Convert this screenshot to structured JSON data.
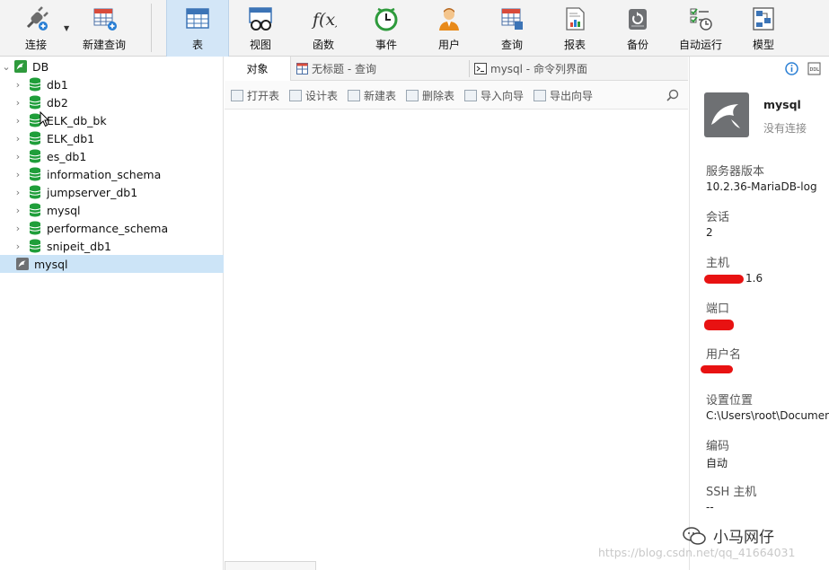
{
  "toolbar": {
    "items": [
      {
        "label": "连接",
        "icon": "plug-connect-icon"
      },
      {
        "label": "新建查询",
        "icon": "new-query-icon"
      },
      {
        "label": "表",
        "icon": "table-icon",
        "active": true
      },
      {
        "label": "视图",
        "icon": "view-icon"
      },
      {
        "label": "函数",
        "icon": "function-icon"
      },
      {
        "label": "事件",
        "icon": "event-clock-icon"
      },
      {
        "label": "用户",
        "icon": "user-icon"
      },
      {
        "label": "查询",
        "icon": "query-icon"
      },
      {
        "label": "报表",
        "icon": "report-icon"
      },
      {
        "label": "备份",
        "icon": "backup-icon"
      },
      {
        "label": "自动运行",
        "icon": "auto-run-icon"
      },
      {
        "label": "模型",
        "icon": "model-icon"
      }
    ]
  },
  "tree": {
    "connection": "DB",
    "databases": [
      "db1",
      "db2",
      "ELK_db_bk",
      "ELK_db1",
      "es_db1",
      "information_schema",
      "jumpserver_db1",
      "mysql",
      "performance_schema",
      "snipeit_db1"
    ],
    "selected_connection": "mysql"
  },
  "tabs": {
    "objects": "对象",
    "query": "无标题 - 查询",
    "console": "mysql - 命令列界面"
  },
  "object_toolbar": {
    "open": "打开表",
    "design": "设计表",
    "new": "新建表",
    "delete": "删除表",
    "import": "导入向导",
    "export": "导出向导"
  },
  "info_panel": {
    "name": "mysql",
    "status": "没有连接",
    "server_version_label": "服务器版本",
    "server_version": "10.2.36-MariaDB-log",
    "sessions_label": "会话",
    "sessions": "2",
    "host_label": "主机",
    "host_value_visible": "1.6",
    "port_label": "端口",
    "username_label": "用户名",
    "location_label": "设置位置",
    "location": "C:\\Users\\root\\Documen",
    "encoding_label": "编码",
    "encoding": "自动",
    "ssh_label": "SSH 主机",
    "ssh_value": "--"
  },
  "watermark": "https://blog.csdn.net/qq_41664031",
  "wechat_label": "小马网仔",
  "colors": {
    "accent_selected": "#cce4f7",
    "toolbar_active": "#d3e6f7",
    "db_green": "#1f9e3a",
    "redaction": "#e81212"
  }
}
